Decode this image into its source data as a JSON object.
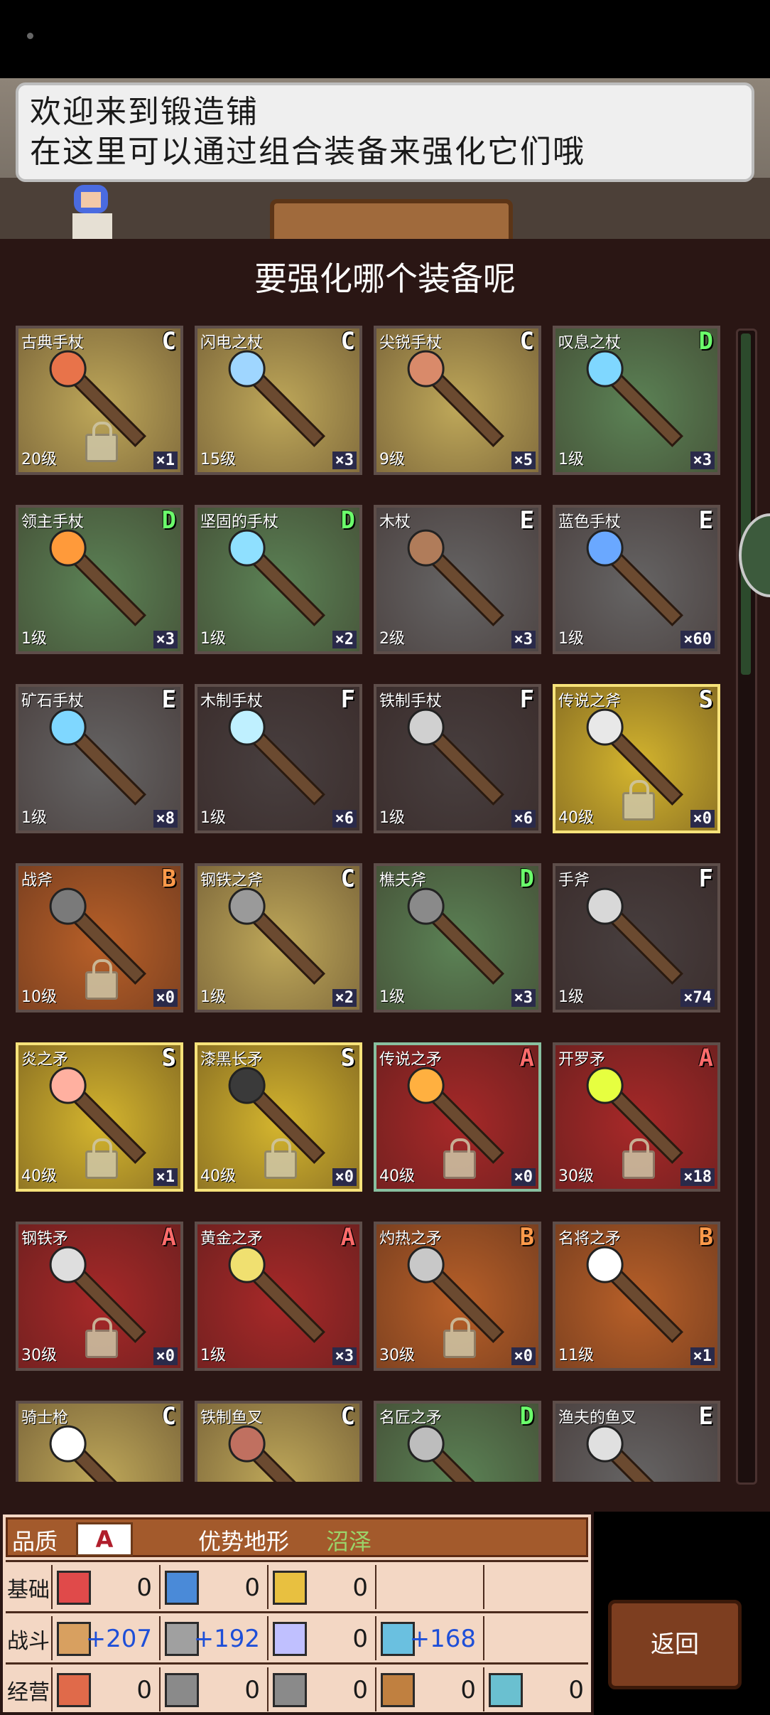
{
  "dialog": {
    "line1": "欢迎来到锻造铺",
    "line2": "在这里可以通过组合装备来强化它们哦"
  },
  "panel": {
    "title": "要强化哪个装备呢"
  },
  "grade_colors": {
    "S": "#ffffff",
    "A": "#ff6b6b",
    "B": "#ff9a4a",
    "C": "#ffffff",
    "D": "#6bff6b",
    "E": "#ffffff",
    "F": "#ffffff"
  },
  "items": [
    {
      "name": "古典手杖",
      "grade": "C",
      "level": "20级",
      "count": "×1",
      "locked": true,
      "bg": "#c9b25e",
      "tip": "#e8734a"
    },
    {
      "name": "闪电之杖",
      "grade": "C",
      "level": "15级",
      "count": "×3",
      "locked": false,
      "bg": "#c9b25e",
      "tip": "#9fd6ff"
    },
    {
      "name": "尖锐手杖",
      "grade": "C",
      "level": "9级",
      "count": "×5",
      "locked": false,
      "bg": "#c9b25e",
      "tip": "#d98a6a"
    },
    {
      "name": "叹息之杖",
      "grade": "D",
      "level": "1级",
      "count": "×3",
      "locked": false,
      "bg": "#5f8a5a",
      "tip": "#7fd7ff"
    },
    {
      "name": "领主手杖",
      "grade": "D",
      "level": "1级",
      "count": "×3",
      "locked": false,
      "bg": "#5f8a5a",
      "tip": "#ff9a3a"
    },
    {
      "name": "坚固的手杖",
      "grade": "D",
      "level": "1级",
      "count": "×2",
      "locked": false,
      "bg": "#5f8a5a",
      "tip": "#8fe0ff"
    },
    {
      "name": "木杖",
      "grade": "E",
      "level": "2级",
      "count": "×3",
      "locked": false,
      "bg": "#6a6a6a",
      "tip": "#b07c5a"
    },
    {
      "name": "蓝色手杖",
      "grade": "E",
      "level": "1级",
      "count": "×60",
      "locked": false,
      "bg": "#6a6a6a",
      "tip": "#6aa8ff"
    },
    {
      "name": "矿石手杖",
      "grade": "E",
      "level": "1级",
      "count": "×8",
      "locked": false,
      "bg": "#6a6a6a",
      "tip": "#7fd7ff"
    },
    {
      "name": "木制手杖",
      "grade": "F",
      "level": "1级",
      "count": "×6",
      "locked": false,
      "bg": "#4a4242",
      "tip": "#bff0ff"
    },
    {
      "name": "铁制手杖",
      "grade": "F",
      "level": "1级",
      "count": "×6",
      "locked": false,
      "bg": "#4a4242",
      "tip": "#d0d0d0"
    },
    {
      "name": "传说之斧",
      "grade": "S",
      "level": "40级",
      "count": "×0",
      "locked": true,
      "bg": "#e0c030",
      "tip": "#e8e8e8"
    },
    {
      "name": "战斧",
      "grade": "B",
      "level": "10级",
      "count": "×0",
      "locked": true,
      "bg": "#c2652a",
      "tip": "#7a7a7a"
    },
    {
      "name": "钢铁之斧",
      "grade": "C",
      "level": "1级",
      "count": "×2",
      "locked": false,
      "bg": "#c9b25e",
      "tip": "#9a9a9a"
    },
    {
      "name": "樵夫斧",
      "grade": "D",
      "level": "1级",
      "count": "×3",
      "locked": false,
      "bg": "#5f8a5a",
      "tip": "#8a8a8a"
    },
    {
      "name": "手斧",
      "grade": "F",
      "level": "1级",
      "count": "×74",
      "locked": false,
      "bg": "#4a4242",
      "tip": "#d8d8d8"
    },
    {
      "name": "炎之矛",
      "grade": "S",
      "level": "40级",
      "count": "×1",
      "locked": true,
      "bg": "#e0c030",
      "tip": "#ffb0a0"
    },
    {
      "name": "漆黑长矛",
      "grade": "S",
      "level": "40级",
      "count": "×0",
      "locked": true,
      "bg": "#e0c030",
      "tip": "#3a3a3a"
    },
    {
      "name": "传说之矛",
      "grade": "A",
      "level": "40级",
      "count": "×0",
      "locked": true,
      "bg": "#b02a2a",
      "tip": "#ffb040"
    },
    {
      "name": "开罗矛",
      "grade": "A",
      "level": "30级",
      "count": "×18",
      "locked": true,
      "bg": "#b02a2a",
      "tip": "#e6ff40"
    },
    {
      "name": "钢铁矛",
      "grade": "A",
      "level": "30级",
      "count": "×0",
      "locked": true,
      "bg": "#b02a2a",
      "tip": "#dedede"
    },
    {
      "name": "黄金之矛",
      "grade": "A",
      "level": "1级",
      "count": "×3",
      "locked": false,
      "bg": "#b02a2a",
      "tip": "#f0e070"
    },
    {
      "name": "灼热之矛",
      "grade": "B",
      "level": "30级",
      "count": "×0",
      "locked": true,
      "bg": "#c2652a",
      "tip": "#c8c8c8"
    },
    {
      "name": "名将之矛",
      "grade": "B",
      "level": "11级",
      "count": "×1",
      "locked": false,
      "bg": "#c2652a",
      "tip": "#ffffff"
    },
    {
      "name": "骑士枪",
      "grade": "C",
      "level": "",
      "count": "",
      "locked": false,
      "bg": "#c9b25e",
      "tip": "#ffffff"
    },
    {
      "name": "铁制鱼叉",
      "grade": "C",
      "level": "",
      "count": "",
      "locked": false,
      "bg": "#c9b25e",
      "tip": "#c07060"
    },
    {
      "name": "名匠之矛",
      "grade": "D",
      "level": "",
      "count": "",
      "locked": false,
      "bg": "#5f8a5a",
      "tip": "#bdbdbd"
    },
    {
      "name": "渔夫的鱼叉",
      "grade": "E",
      "level": "",
      "count": "",
      "locked": false,
      "bg": "#6a6a6a",
      "tip": "#e0e0e0"
    }
  ],
  "stats": {
    "quality_label": "品质",
    "quality_value": "A",
    "terrain_label": "优势地形",
    "terrain_value": "沼泽",
    "rows": [
      {
        "label": "基础",
        "cells": [
          {
            "icon": "heart-icon",
            "color": "#e04a4a",
            "value": "0"
          },
          {
            "icon": "potion-icon",
            "color": "#4a8ad8",
            "value": "0"
          },
          {
            "icon": "arm-icon",
            "color": "#e8c040",
            "value": "0"
          }
        ]
      },
      {
        "label": "战斗",
        "cells": [
          {
            "icon": "sword-icon",
            "color": "#d8a060",
            "value": "+207"
          },
          {
            "icon": "shield-icon",
            "color": "#a0a0a0",
            "value": "+192"
          },
          {
            "icon": "arrows-icon",
            "color": "#c0c0ff",
            "value": "0"
          },
          {
            "icon": "star-icon",
            "color": "#6ac0e0",
            "value": "+168"
          }
        ]
      },
      {
        "label": "经营",
        "cells": [
          {
            "icon": "book-icon",
            "color": "#e06a4a",
            "value": "0"
          },
          {
            "icon": "hammer-icon",
            "color": "#8a8a8a",
            "value": "0"
          },
          {
            "icon": "shovel-icon",
            "color": "#8a8a8a",
            "value": "0"
          },
          {
            "icon": "chest-icon",
            "color": "#c08040",
            "value": "0"
          },
          {
            "icon": "gem-icon",
            "color": "#6ac0d0",
            "value": "0"
          }
        ]
      }
    ]
  },
  "back_button": "返回"
}
